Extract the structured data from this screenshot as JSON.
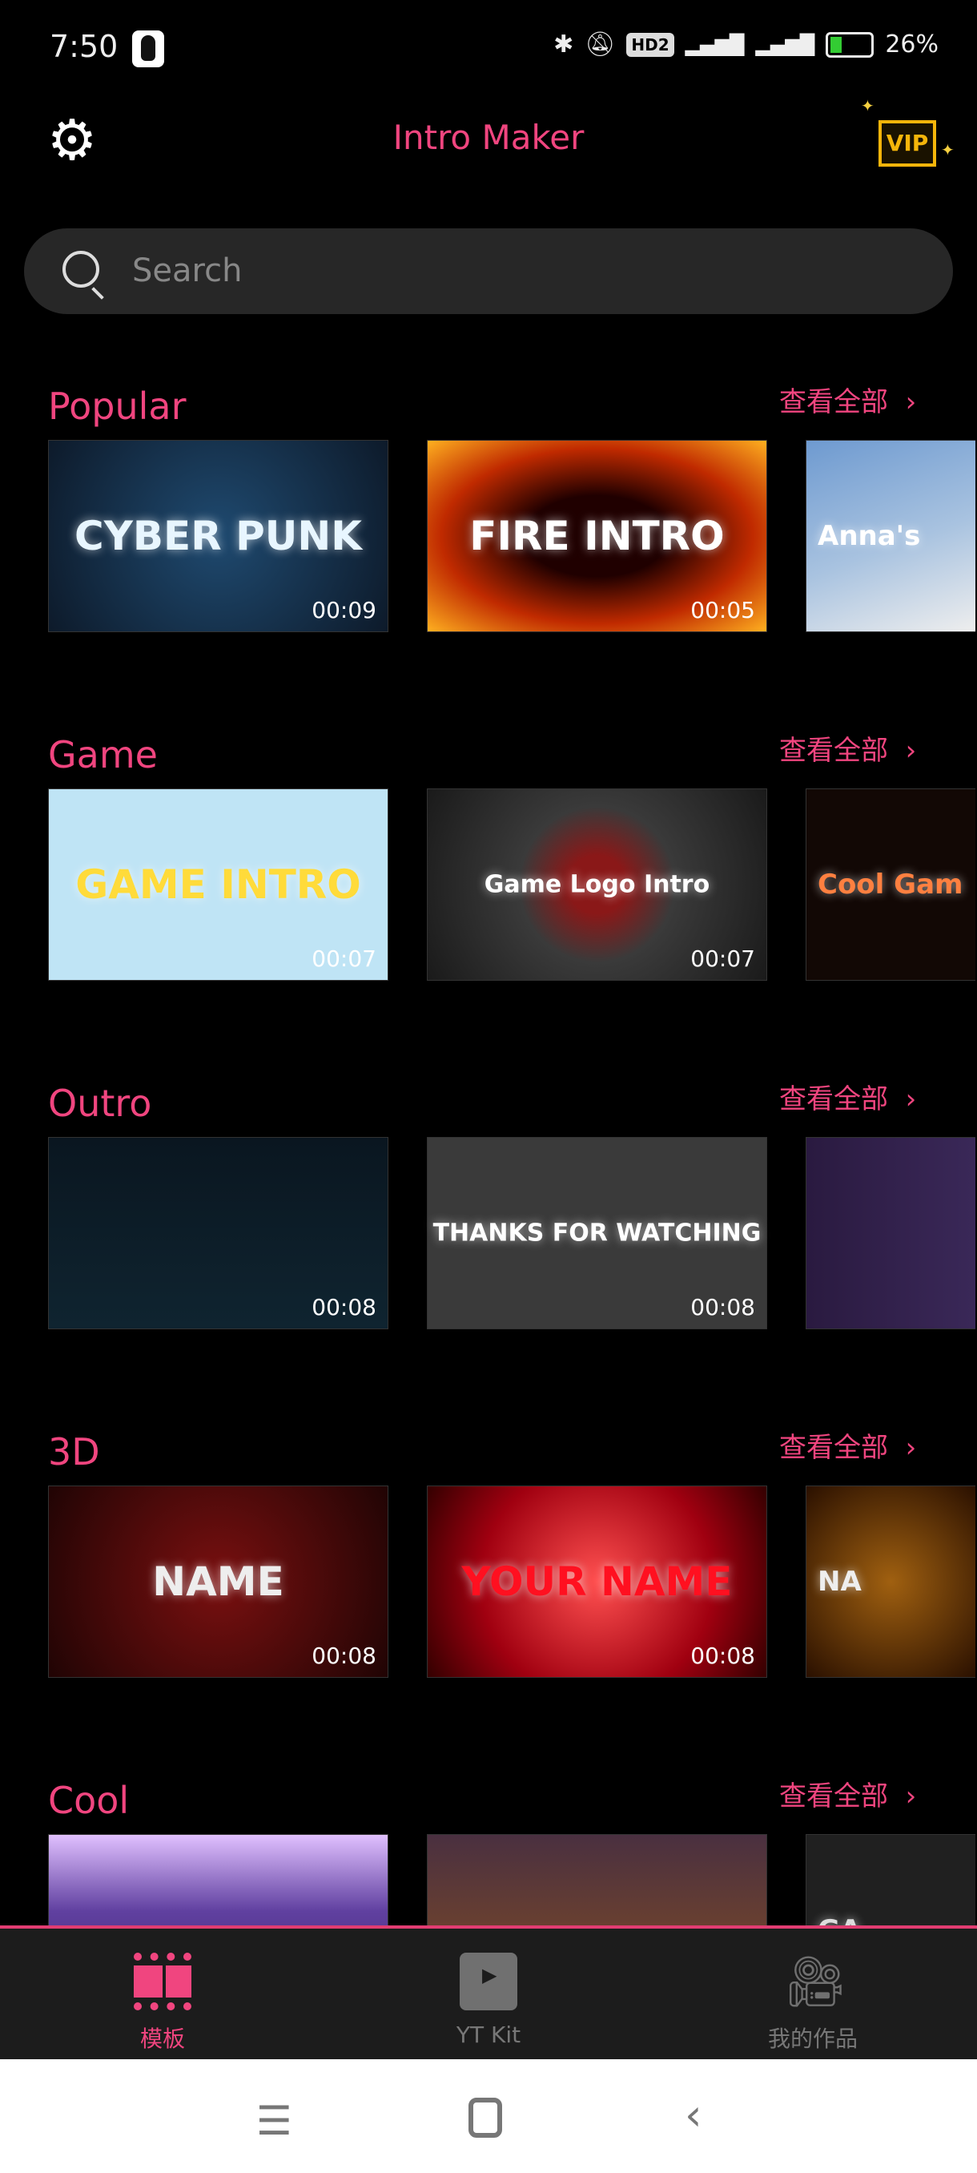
{
  "status_bar": {
    "time": "7:50",
    "battery": "26%",
    "network": "4G",
    "hd": "HD2"
  },
  "header": {
    "title": "Intro Maker",
    "vip_label": "VIP"
  },
  "search": {
    "placeholder": "Search"
  },
  "see_all_label": "查看全部",
  "sections": [
    {
      "title": "Popular",
      "items": [
        {
          "text": "CYBER PUNK",
          "duration": "00:09",
          "bg": "radial-gradient(circle at 50% 50%,#1f4a70,#0d1a2a)",
          "color": "#e8f6ff"
        },
        {
          "text": "FIRE INTRO",
          "duration": "00:05",
          "bg": "radial-gradient(ellipse at 50% 50%,#200000 30%,#c02a00 65%,#ffb020)",
          "color": "#fff"
        },
        {
          "text": "Anna's",
          "duration": "",
          "bg": "linear-gradient(160deg,#6e9ad0,#a9c3e0 55%,#eee)",
          "color": "#fff"
        }
      ]
    },
    {
      "title": "Game",
      "items": [
        {
          "text": "GAME INTRO",
          "duration": "00:07",
          "bg": "#bfe4f5",
          "color": "#ffdb3a"
        },
        {
          "text": "Game Logo Intro",
          "duration": "00:07",
          "bg": "radial-gradient(circle,#8a1818 15%,#3a3a3a 40%,#1a1a1a)",
          "color": "#fff"
        },
        {
          "text": "Cool Gam",
          "duration": "",
          "bg": "#120805",
          "color": "#ff8040"
        }
      ]
    },
    {
      "title": "Outro",
      "items": [
        {
          "text": "",
          "duration": "00:08",
          "bg": "linear-gradient(#0a1620,#0f2430)",
          "color": "#4ff"
        },
        {
          "text": "THANKS FOR WATCHING",
          "duration": "00:08",
          "bg": "#3a3a3a",
          "color": "#fff"
        },
        {
          "text": "",
          "duration": "",
          "bg": "linear-gradient(90deg,#2a1a40,#3a2858)",
          "color": "#c080ff"
        }
      ]
    },
    {
      "title": "3D",
      "items": [
        {
          "text": "NAME",
          "duration": "00:08",
          "bg": "radial-gradient(circle,#7a1010,#200404)",
          "color": "#eee"
        },
        {
          "text": "YOUR NAME",
          "duration": "00:08",
          "bg": "radial-gradient(circle,#ff5050,#a00010 60%,#300)",
          "color": "#ff1020"
        },
        {
          "text": "NA",
          "duration": "",
          "bg": "radial-gradient(circle,#a06010,#2a1000)",
          "color": "#eee"
        }
      ]
    },
    {
      "title": "Cool",
      "items": [
        {
          "text": "",
          "duration": "",
          "bg": "linear-gradient(#e0c0ff,#6040a0 40%,#3a2060)",
          "color": "#fff"
        },
        {
          "text": "",
          "duration": "",
          "bg": "linear-gradient(#4a3040,#6a4030 50%,#2a2020)",
          "color": "#fff"
        },
        {
          "text": "GA",
          "duration": "",
          "bg": "#202020",
          "color": "#ddd"
        }
      ]
    }
  ],
  "bottom_nav": [
    {
      "label": "模板",
      "active": true
    },
    {
      "label": "YT Kit",
      "active": false
    },
    {
      "label": "我的作品",
      "active": false
    }
  ],
  "colors": {
    "accent": "#f0457f",
    "vip": "#f5b50a",
    "nav_bg": "#1c1c1c",
    "search_bg": "#272727"
  }
}
